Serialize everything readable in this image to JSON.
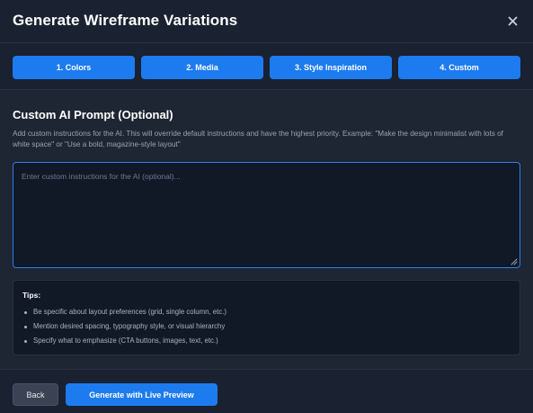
{
  "modal": {
    "title": "Generate Wireframe Variations",
    "close_icon": "close-icon"
  },
  "tabs": [
    {
      "label": "1. Colors"
    },
    {
      "label": "2. Media"
    },
    {
      "label": "3. Style Inspiration"
    },
    {
      "label": "4. Custom"
    }
  ],
  "custom_prompt": {
    "title": "Custom AI Prompt (Optional)",
    "description": "Add custom instructions for the AI. This will override default instructions and have the highest priority. Example: \"Make the design minimalist with lots of white space\" or \"Use a bold, magazine-style layout\"",
    "value": "",
    "placeholder": "Enter custom instructions for the AI (optional)..."
  },
  "tips": {
    "title": "Tips:",
    "items": [
      "Be specific about layout preferences (grid, single column, etc.)",
      "Mention desired spacing, typography style, or visual hierarchy",
      "Specify what to emphasize (CTA buttons, images, text, etc.)"
    ]
  },
  "footer": {
    "back_label": "Back",
    "generate_label": "Generate with Live Preview"
  },
  "colors": {
    "accent": "#1d7bf0",
    "background": "#1e2533",
    "panel": "#111927"
  }
}
